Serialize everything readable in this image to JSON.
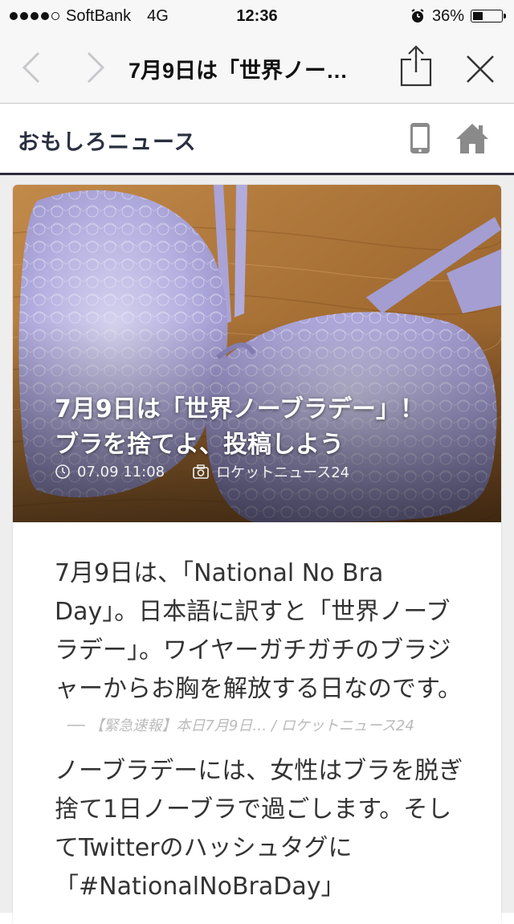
{
  "status_bar": {
    "carrier": "SoftBank",
    "network": "4G",
    "time": "12:36",
    "battery_percent": "36%",
    "battery_level": 0.36,
    "signal_bars_filled": 4,
    "signal_bars_total": 5
  },
  "browser": {
    "title": "7月9日は「世界ノー…",
    "back_icon": "chevron-left-icon",
    "forward_icon": "chevron-right-icon",
    "share_icon": "share-icon",
    "close_icon": "close-icon"
  },
  "site": {
    "name": "おもしろニュース",
    "mobile_icon": "mobile-phone-icon",
    "home_icon": "home-icon"
  },
  "article": {
    "title_line1": "7月9日は「世界ノーブラデー」！",
    "title_line2": "ブラを捨てよ、投稿しよう",
    "date": "07.09 11:08",
    "source": "ロケットニュース24",
    "paragraph1": "7月9日は、「National No Bra Day」。日本語に訳すと「世界ノーブラデー」。ワイヤーガチガチのブラジャーからお胸を解放する日なのです。",
    "quote_source": "── 【緊急速報】本日7月9日… / ロケットニュース24",
    "paragraph2": "ノーブラデーには、女性はブラを脱ぎ捨て1日ノーブラで過ごします。そしてTwitterのハッシュタグに「#NationalNoBraDay」"
  },
  "colors": {
    "accent_dark": "#2b3040",
    "icon_gray": "#8a8a8a",
    "ios_bar": "#f7f7f7"
  }
}
